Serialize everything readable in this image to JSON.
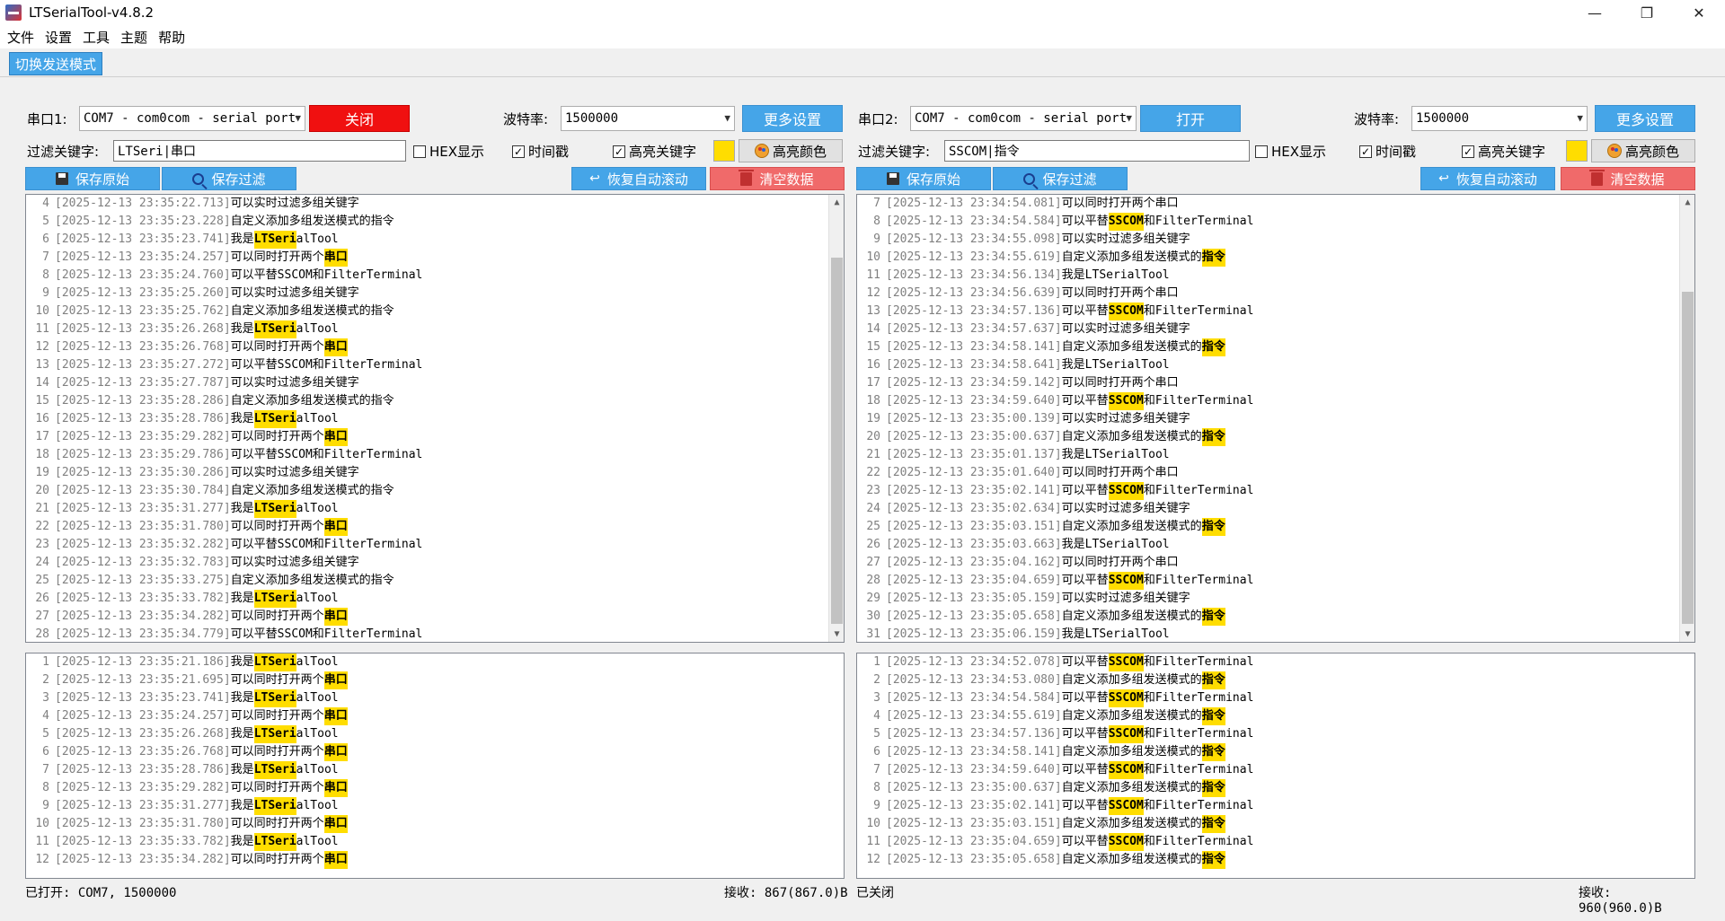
{
  "window": {
    "title": "LTSerialTool-v4.8.2",
    "minimize": "—",
    "maximize": "❐",
    "close": "✕"
  },
  "menu": [
    "文件",
    "设置",
    "工具",
    "主题",
    "帮助"
  ],
  "toolbar": {
    "mode_button": "切换发送模式"
  },
  "colors": {
    "accent": "#45a5e8",
    "close_red": "#f01010",
    "clear_pink": "#f06a6a",
    "highlight": "#ffdd00"
  },
  "left": {
    "port_label": "串口1:",
    "port_value": "COM7 - com0com - serial port",
    "port_button": "关闭",
    "baud_label": "波特率:",
    "baud_value": "1500000",
    "more_button": "更多设置",
    "filter_label": "过滤关键字:",
    "filter_value": "LTSeri|串口",
    "hex_label": "HEX显示",
    "hex_checked": false,
    "timestamp_label": "时间戳",
    "timestamp_checked": true,
    "highlight_label": "高亮关键字",
    "highlight_checked": true,
    "color_button": "高亮颜色",
    "save_raw": "保存原始",
    "save_filter": "保存过滤",
    "restore_scroll": "恢复自动滚动",
    "clear_data": "清空数据",
    "status_left": "已打开: COM7, 1500000",
    "status_right": "接收: 867(867.0)B",
    "log": [
      {
        "n": "4",
        "ts": "[2025-12-13 23:35:22.713]",
        "segs": [
          [
            "可以实时过滤多组关键字",
            0
          ]
        ]
      },
      {
        "n": "5",
        "ts": "[2025-12-13 23:35:23.228]",
        "segs": [
          [
            "自定义添加多组发送模式的指令",
            0
          ]
        ]
      },
      {
        "n": "6",
        "ts": "[2025-12-13 23:35:23.741]",
        "segs": [
          [
            "我是",
            0
          ],
          [
            "LTSeri",
            1
          ],
          [
            "alTool",
            0
          ]
        ]
      },
      {
        "n": "7",
        "ts": "[2025-12-13 23:35:24.257]",
        "segs": [
          [
            "可以同时打开两个",
            0
          ],
          [
            "串口",
            1
          ]
        ]
      },
      {
        "n": "8",
        "ts": "[2025-12-13 23:35:24.760]",
        "segs": [
          [
            "可以平替SSCOM和FilterTerminal",
            0
          ]
        ]
      },
      {
        "n": "9",
        "ts": "[2025-12-13 23:35:25.260]",
        "segs": [
          [
            "可以实时过滤多组关键字",
            0
          ]
        ]
      },
      {
        "n": "10",
        "ts": "[2025-12-13 23:35:25.762]",
        "segs": [
          [
            "自定义添加多组发送模式的指令",
            0
          ]
        ]
      },
      {
        "n": "11",
        "ts": "[2025-12-13 23:35:26.268]",
        "segs": [
          [
            "我是",
            0
          ],
          [
            "LTSeri",
            1
          ],
          [
            "alTool",
            0
          ]
        ]
      },
      {
        "n": "12",
        "ts": "[2025-12-13 23:35:26.768]",
        "segs": [
          [
            "可以同时打开两个",
            0
          ],
          [
            "串口",
            1
          ]
        ]
      },
      {
        "n": "13",
        "ts": "[2025-12-13 23:35:27.272]",
        "segs": [
          [
            "可以平替SSCOM和FilterTerminal",
            0
          ]
        ]
      },
      {
        "n": "14",
        "ts": "[2025-12-13 23:35:27.787]",
        "segs": [
          [
            "可以实时过滤多组关键字",
            0
          ]
        ]
      },
      {
        "n": "15",
        "ts": "[2025-12-13 23:35:28.286]",
        "segs": [
          [
            "自定义添加多组发送模式的指令",
            0
          ]
        ]
      },
      {
        "n": "16",
        "ts": "[2025-12-13 23:35:28.786]",
        "segs": [
          [
            "我是",
            0
          ],
          [
            "LTSeri",
            1
          ],
          [
            "alTool",
            0
          ]
        ]
      },
      {
        "n": "17",
        "ts": "[2025-12-13 23:35:29.282]",
        "segs": [
          [
            "可以同时打开两个",
            0
          ],
          [
            "串口",
            1
          ]
        ]
      },
      {
        "n": "18",
        "ts": "[2025-12-13 23:35:29.786]",
        "segs": [
          [
            "可以平替SSCOM和FilterTerminal",
            0
          ]
        ]
      },
      {
        "n": "19",
        "ts": "[2025-12-13 23:35:30.286]",
        "segs": [
          [
            "可以实时过滤多组关键字",
            0
          ]
        ]
      },
      {
        "n": "20",
        "ts": "[2025-12-13 23:35:30.784]",
        "segs": [
          [
            "自定义添加多组发送模式的指令",
            0
          ]
        ]
      },
      {
        "n": "21",
        "ts": "[2025-12-13 23:35:31.277]",
        "segs": [
          [
            "我是",
            0
          ],
          [
            "LTSeri",
            1
          ],
          [
            "alTool",
            0
          ]
        ]
      },
      {
        "n": "22",
        "ts": "[2025-12-13 23:35:31.780]",
        "segs": [
          [
            "可以同时打开两个",
            0
          ],
          [
            "串口",
            1
          ]
        ]
      },
      {
        "n": "23",
        "ts": "[2025-12-13 23:35:32.282]",
        "segs": [
          [
            "可以平替SSCOM和FilterTerminal",
            0
          ]
        ]
      },
      {
        "n": "24",
        "ts": "[2025-12-13 23:35:32.783]",
        "segs": [
          [
            "可以实时过滤多组关键字",
            0
          ]
        ]
      },
      {
        "n": "25",
        "ts": "[2025-12-13 23:35:33.275]",
        "segs": [
          [
            "自定义添加多组发送模式的指令",
            0
          ]
        ]
      },
      {
        "n": "26",
        "ts": "[2025-12-13 23:35:33.782]",
        "segs": [
          [
            "我是",
            0
          ],
          [
            "LTSeri",
            1
          ],
          [
            "alTool",
            0
          ]
        ]
      },
      {
        "n": "27",
        "ts": "[2025-12-13 23:35:34.282]",
        "segs": [
          [
            "可以同时打开两个",
            0
          ],
          [
            "串口",
            1
          ]
        ]
      },
      {
        "n": "28",
        "ts": "[2025-12-13 23:35:34.779]",
        "segs": [
          [
            "可以平替SSCOM和FilterTerminal",
            0
          ]
        ]
      }
    ],
    "filtered": [
      {
        "n": "1",
        "ts": "[2025-12-13 23:35:21.186]",
        "segs": [
          [
            "我是",
            0
          ],
          [
            "LTSeri",
            1
          ],
          [
            "alTool",
            0
          ]
        ]
      },
      {
        "n": "2",
        "ts": "[2025-12-13 23:35:21.695]",
        "segs": [
          [
            "可以同时打开两个",
            0
          ],
          [
            "串口",
            1
          ]
        ]
      },
      {
        "n": "3",
        "ts": "[2025-12-13 23:35:23.741]",
        "segs": [
          [
            "我是",
            0
          ],
          [
            "LTSeri",
            1
          ],
          [
            "alTool",
            0
          ]
        ]
      },
      {
        "n": "4",
        "ts": "[2025-12-13 23:35:24.257]",
        "segs": [
          [
            "可以同时打开两个",
            0
          ],
          [
            "串口",
            1
          ]
        ]
      },
      {
        "n": "5",
        "ts": "[2025-12-13 23:35:26.268]",
        "segs": [
          [
            "我是",
            0
          ],
          [
            "LTSeri",
            1
          ],
          [
            "alTool",
            0
          ]
        ]
      },
      {
        "n": "6",
        "ts": "[2025-12-13 23:35:26.768]",
        "segs": [
          [
            "可以同时打开两个",
            0
          ],
          [
            "串口",
            1
          ]
        ]
      },
      {
        "n": "7",
        "ts": "[2025-12-13 23:35:28.786]",
        "segs": [
          [
            "我是",
            0
          ],
          [
            "LTSeri",
            1
          ],
          [
            "alTool",
            0
          ]
        ]
      },
      {
        "n": "8",
        "ts": "[2025-12-13 23:35:29.282]",
        "segs": [
          [
            "可以同时打开两个",
            0
          ],
          [
            "串口",
            1
          ]
        ]
      },
      {
        "n": "9",
        "ts": "[2025-12-13 23:35:31.277]",
        "segs": [
          [
            "我是",
            0
          ],
          [
            "LTSeri",
            1
          ],
          [
            "alTool",
            0
          ]
        ]
      },
      {
        "n": "10",
        "ts": "[2025-12-13 23:35:31.780]",
        "segs": [
          [
            "可以同时打开两个",
            0
          ],
          [
            "串口",
            1
          ]
        ]
      },
      {
        "n": "11",
        "ts": "[2025-12-13 23:35:33.782]",
        "segs": [
          [
            "我是",
            0
          ],
          [
            "LTSeri",
            1
          ],
          [
            "alTool",
            0
          ]
        ]
      },
      {
        "n": "12",
        "ts": "[2025-12-13 23:35:34.282]",
        "segs": [
          [
            "可以同时打开两个",
            0
          ],
          [
            "串口",
            1
          ]
        ]
      }
    ]
  },
  "right": {
    "port_label": "串口2:",
    "port_value": "COM7 - com0com - serial port",
    "port_button": "打开",
    "baud_label": "波特率:",
    "baud_value": "1500000",
    "more_button": "更多设置",
    "filter_label": "过滤关键字:",
    "filter_value": "SSCOM|指令",
    "hex_label": "HEX显示",
    "hex_checked": false,
    "timestamp_label": "时间戳",
    "timestamp_checked": true,
    "highlight_label": "高亮关键字",
    "highlight_checked": true,
    "color_button": "高亮颜色",
    "save_raw": "保存原始",
    "save_filter": "保存过滤",
    "restore_scroll": "恢复自动滚动",
    "clear_data": "清空数据",
    "status_left": "已关闭",
    "status_right": "接收: 960(960.0)B",
    "log": [
      {
        "n": "7",
        "ts": "[2025-12-13 23:34:54.081]",
        "segs": [
          [
            "可以同时打开两个串口",
            0
          ]
        ]
      },
      {
        "n": "8",
        "ts": "[2025-12-13 23:34:54.584]",
        "segs": [
          [
            "可以平替",
            0
          ],
          [
            "SSCOM",
            1
          ],
          [
            "和FilterTerminal",
            0
          ]
        ]
      },
      {
        "n": "9",
        "ts": "[2025-12-13 23:34:55.098]",
        "segs": [
          [
            "可以实时过滤多组关键字",
            0
          ]
        ]
      },
      {
        "n": "10",
        "ts": "[2025-12-13 23:34:55.619]",
        "segs": [
          [
            "自定义添加多组发送模式的",
            0
          ],
          [
            "指令",
            1
          ]
        ]
      },
      {
        "n": "11",
        "ts": "[2025-12-13 23:34:56.134]",
        "segs": [
          [
            "我是LTSerialTool",
            0
          ]
        ]
      },
      {
        "n": "12",
        "ts": "[2025-12-13 23:34:56.639]",
        "segs": [
          [
            "可以同时打开两个串口",
            0
          ]
        ]
      },
      {
        "n": "13",
        "ts": "[2025-12-13 23:34:57.136]",
        "segs": [
          [
            "可以平替",
            0
          ],
          [
            "SSCOM",
            1
          ],
          [
            "和FilterTerminal",
            0
          ]
        ]
      },
      {
        "n": "14",
        "ts": "[2025-12-13 23:34:57.637]",
        "segs": [
          [
            "可以实时过滤多组关键字",
            0
          ]
        ]
      },
      {
        "n": "15",
        "ts": "[2025-12-13 23:34:58.141]",
        "segs": [
          [
            "自定义添加多组发送模式的",
            0
          ],
          [
            "指令",
            1
          ]
        ]
      },
      {
        "n": "16",
        "ts": "[2025-12-13 23:34:58.641]",
        "segs": [
          [
            "我是LTSerialTool",
            0
          ]
        ]
      },
      {
        "n": "17",
        "ts": "[2025-12-13 23:34:59.142]",
        "segs": [
          [
            "可以同时打开两个串口",
            0
          ]
        ]
      },
      {
        "n": "18",
        "ts": "[2025-12-13 23:34:59.640]",
        "segs": [
          [
            "可以平替",
            0
          ],
          [
            "SSCOM",
            1
          ],
          [
            "和FilterTerminal",
            0
          ]
        ]
      },
      {
        "n": "19",
        "ts": "[2025-12-13 23:35:00.139]",
        "segs": [
          [
            "可以实时过滤多组关键字",
            0
          ]
        ]
      },
      {
        "n": "20",
        "ts": "[2025-12-13 23:35:00.637]",
        "segs": [
          [
            "自定义添加多组发送模式的",
            0
          ],
          [
            "指令",
            1
          ]
        ]
      },
      {
        "n": "21",
        "ts": "[2025-12-13 23:35:01.137]",
        "segs": [
          [
            "我是LTSerialTool",
            0
          ]
        ]
      },
      {
        "n": "22",
        "ts": "[2025-12-13 23:35:01.640]",
        "segs": [
          [
            "可以同时打开两个串口",
            0
          ]
        ]
      },
      {
        "n": "23",
        "ts": "[2025-12-13 23:35:02.141]",
        "segs": [
          [
            "可以平替",
            0
          ],
          [
            "SSCOM",
            1
          ],
          [
            "和FilterTerminal",
            0
          ]
        ]
      },
      {
        "n": "24",
        "ts": "[2025-12-13 23:35:02.634]",
        "segs": [
          [
            "可以实时过滤多组关键字",
            0
          ]
        ]
      },
      {
        "n": "25",
        "ts": "[2025-12-13 23:35:03.151]",
        "segs": [
          [
            "自定义添加多组发送模式的",
            0
          ],
          [
            "指令",
            1
          ]
        ]
      },
      {
        "n": "26",
        "ts": "[2025-12-13 23:35:03.663]",
        "segs": [
          [
            "我是LTSerialTool",
            0
          ]
        ]
      },
      {
        "n": "27",
        "ts": "[2025-12-13 23:35:04.162]",
        "segs": [
          [
            "可以同时打开两个串口",
            0
          ]
        ]
      },
      {
        "n": "28",
        "ts": "[2025-12-13 23:35:04.659]",
        "segs": [
          [
            "可以平替",
            0
          ],
          [
            "SSCOM",
            1
          ],
          [
            "和FilterTerminal",
            0
          ]
        ]
      },
      {
        "n": "29",
        "ts": "[2025-12-13 23:35:05.159]",
        "segs": [
          [
            "可以实时过滤多组关键字",
            0
          ]
        ]
      },
      {
        "n": "30",
        "ts": "[2025-12-13 23:35:05.658]",
        "segs": [
          [
            "自定义添加多组发送模式的",
            0
          ],
          [
            "指令",
            1
          ]
        ]
      },
      {
        "n": "31",
        "ts": "[2025-12-13 23:35:06.159]",
        "segs": [
          [
            "我是LTSerialTool",
            0
          ]
        ]
      }
    ],
    "filtered": [
      {
        "n": "1",
        "ts": "[2025-12-13 23:34:52.078]",
        "segs": [
          [
            "可以平替",
            0
          ],
          [
            "SSCOM",
            1
          ],
          [
            "和FilterTerminal",
            0
          ]
        ]
      },
      {
        "n": "2",
        "ts": "[2025-12-13 23:34:53.080]",
        "segs": [
          [
            "自定义添加多组发送模式的",
            0
          ],
          [
            "指令",
            1
          ]
        ]
      },
      {
        "n": "3",
        "ts": "[2025-12-13 23:34:54.584]",
        "segs": [
          [
            "可以平替",
            0
          ],
          [
            "SSCOM",
            1
          ],
          [
            "和FilterTerminal",
            0
          ]
        ]
      },
      {
        "n": "4",
        "ts": "[2025-12-13 23:34:55.619]",
        "segs": [
          [
            "自定义添加多组发送模式的",
            0
          ],
          [
            "指令",
            1
          ]
        ]
      },
      {
        "n": "5",
        "ts": "[2025-12-13 23:34:57.136]",
        "segs": [
          [
            "可以平替",
            0
          ],
          [
            "SSCOM",
            1
          ],
          [
            "和FilterTerminal",
            0
          ]
        ]
      },
      {
        "n": "6",
        "ts": "[2025-12-13 23:34:58.141]",
        "segs": [
          [
            "自定义添加多组发送模式的",
            0
          ],
          [
            "指令",
            1
          ]
        ]
      },
      {
        "n": "7",
        "ts": "[2025-12-13 23:34:59.640]",
        "segs": [
          [
            "可以平替",
            0
          ],
          [
            "SSCOM",
            1
          ],
          [
            "和FilterTerminal",
            0
          ]
        ]
      },
      {
        "n": "8",
        "ts": "[2025-12-13 23:35:00.637]",
        "segs": [
          [
            "自定义添加多组发送模式的",
            0
          ],
          [
            "指令",
            1
          ]
        ]
      },
      {
        "n": "9",
        "ts": "[2025-12-13 23:35:02.141]",
        "segs": [
          [
            "可以平替",
            0
          ],
          [
            "SSCOM",
            1
          ],
          [
            "和FilterTerminal",
            0
          ]
        ]
      },
      {
        "n": "10",
        "ts": "[2025-12-13 23:35:03.151]",
        "segs": [
          [
            "自定义添加多组发送模式的",
            0
          ],
          [
            "指令",
            1
          ]
        ]
      },
      {
        "n": "11",
        "ts": "[2025-12-13 23:35:04.659]",
        "segs": [
          [
            "可以平替",
            0
          ],
          [
            "SSCOM",
            1
          ],
          [
            "和FilterTerminal",
            0
          ]
        ]
      },
      {
        "n": "12",
        "ts": "[2025-12-13 23:35:05.658]",
        "segs": [
          [
            "自定义添加多组发送模式的",
            0
          ],
          [
            "指令",
            1
          ]
        ]
      }
    ]
  }
}
